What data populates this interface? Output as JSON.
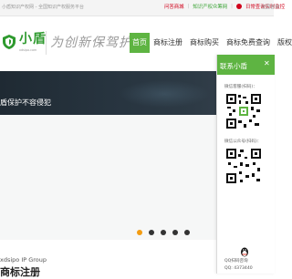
{
  "topbar": {
    "tagline": "小盾知识产权网 - 全国知识产权服务平台",
    "links": [
      "问答商城",
      "知识产权众筹网",
      "日常查询实时监控"
    ],
    "end_text": "全国咨询"
  },
  "header": {
    "logo_text": "小盾",
    "logo_sub": "xdsipo.com",
    "slogan": "为创新保驾护航",
    "nav": [
      "首页",
      "商标注册",
      "商标购买",
      "商标免费查询",
      "版权"
    ]
  },
  "banner": {
    "headline": "盾保护不容侵犯",
    "slide_count": 5,
    "active_slide": 0
  },
  "section": {
    "brand_en": "xdsipo IP Group",
    "title": "商标注册"
  },
  "float_panel": {
    "title": "联系小盾",
    "close_icon": "close-icon",
    "qr_labels": [
      "微信客服(扫码)：",
      "微信公众号(扫码)："
    ],
    "qq_label": "QQ扫码咨询",
    "qq_number": "QQ: 4373440"
  },
  "colors": {
    "accent": "#5eb442",
    "logo": "#2f9a2f",
    "link_red": "#d0021b",
    "dot_active": "#f39c12"
  }
}
